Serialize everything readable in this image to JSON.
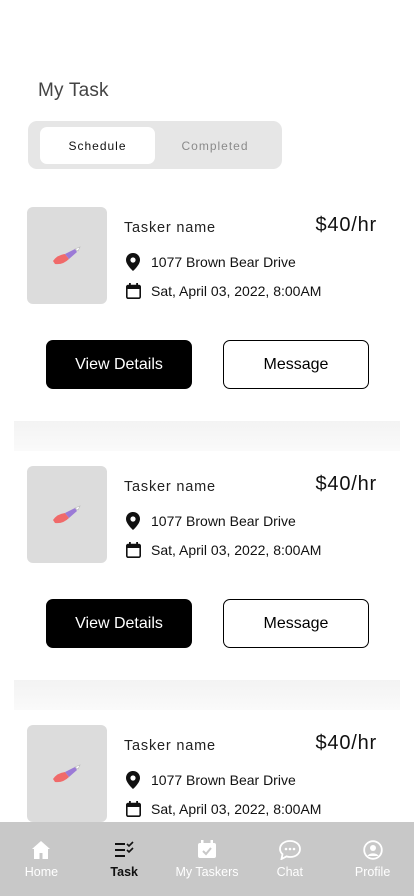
{
  "header": {
    "title": "My Task"
  },
  "segmented": {
    "schedule": "Schedule",
    "completed": "Completed"
  },
  "tasks": [
    {
      "name": "Tasker name",
      "price": "$40/hr",
      "address": "1077  Brown Bear Drive",
      "datetime": "Sat, April 03, 2022, 8:00AM",
      "details_label": "View Details",
      "message_label": "Message"
    },
    {
      "name": "Tasker name",
      "price": "$40/hr",
      "address": "1077  Brown Bear Drive",
      "datetime": "Sat, April 03, 2022, 8:00AM",
      "details_label": "View Details",
      "message_label": "Message"
    },
    {
      "name": "Tasker name",
      "price": "$40/hr",
      "address": "1077  Brown Bear Drive",
      "datetime": "Sat, April 03, 2022, 8:00AM"
    }
  ],
  "tabbar": {
    "items": [
      {
        "label": "Home",
        "icon": "home-icon"
      },
      {
        "label": "Task",
        "icon": "task-list-icon"
      },
      {
        "label": "My Taskers",
        "icon": "taskers-icon"
      },
      {
        "label": "Chat",
        "icon": "chat-icon"
      },
      {
        "label": "Profile",
        "icon": "profile-icon"
      }
    ],
    "active": "Task"
  },
  "colors": {
    "primary_button": "#000000",
    "tab_bar_bg": "#c8c8c8",
    "thumb_bg": "#dcdcdc",
    "accent_brush": "#f06a6a"
  }
}
